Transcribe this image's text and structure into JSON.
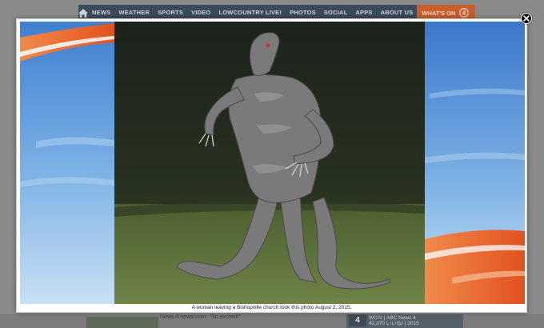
{
  "nav": {
    "items": [
      "NEWS",
      "WEATHER",
      "SPORTS",
      "VIDEO",
      "LOWCOUNTRY LIVE!",
      "PHOTOS",
      "SOCIAL",
      "APPS",
      "ABOUT US"
    ],
    "whats_on": "WHAT'S ON",
    "channel_logo": "4"
  },
  "background": {
    "news_snippet": "News 4 newsroom: \"So excited!\"",
    "card_title": "WCIV | ABC News 4",
    "card_subtitle": "42,370 いいね! | 2015",
    "card_logo": "4"
  },
  "lightbox": {
    "caption": "A woman leaving a Bishopville church took this photo August 2, 2015.",
    "close_icon": "close-icon"
  },
  "colors": {
    "nav_bg": "#3b4a58",
    "whats_on_bg": "#c95e2e",
    "backdrop": "#8a8a8a",
    "accent_orange": "#e8642a",
    "sky_blue": "#4f8fd8"
  }
}
